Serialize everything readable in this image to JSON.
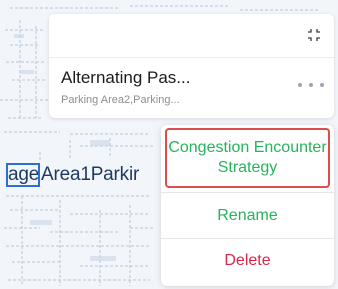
{
  "map": {
    "label_fragment": "age",
    "label_text": "Area1Parkir"
  },
  "card": {
    "title": "Alternating Pas...",
    "subtitle": "Parking Area2,Parking...",
    "expand_icon": "collapse-arrows-icon",
    "more_icon": "more-dots-icon"
  },
  "menu": {
    "congestion_label": "Congestion Encounter Strategy",
    "rename_label": "Rename",
    "delete_label": "Delete"
  },
  "colors": {
    "accent_green": "#27b35c",
    "delete_red": "#d9264a",
    "highlight_border": "#e04b4b"
  }
}
